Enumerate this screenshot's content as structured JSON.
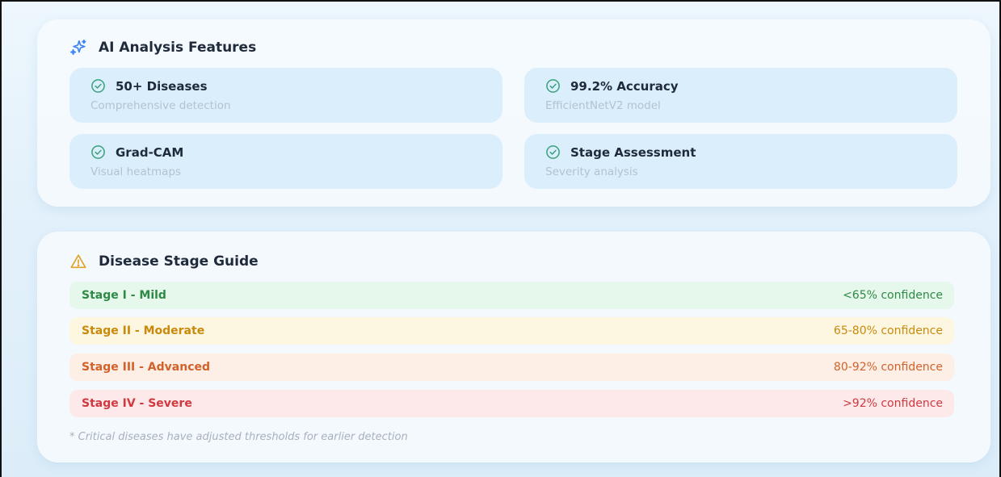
{
  "features": {
    "title": "AI Analysis Features",
    "icon": "sparkles-icon",
    "items": [
      {
        "title": "50+ Diseases",
        "subtitle": "Comprehensive detection",
        "icon": "check-circle-icon"
      },
      {
        "title": "99.2% Accuracy",
        "subtitle": "EfficientNetV2 model",
        "icon": "check-circle-icon"
      },
      {
        "title": "Grad-CAM",
        "subtitle": "Visual heatmaps",
        "icon": "check-circle-icon"
      },
      {
        "title": "Stage Assessment",
        "subtitle": "Severity analysis",
        "icon": "check-circle-icon"
      }
    ]
  },
  "stages": {
    "title": "Disease Stage Guide",
    "icon": "warning-triangle-icon",
    "rows": [
      {
        "name": "Stage I - Mild",
        "confidence": "<65% confidence",
        "color": "#2f8a45",
        "bg": "#e6f7ec"
      },
      {
        "name": "Stage II - Moderate",
        "confidence": "65-80% confidence",
        "color": "#c98a0c",
        "bg": "#fdf7e1"
      },
      {
        "name": "Stage III - Advanced",
        "confidence": "80-92% confidence",
        "color": "#d2622a",
        "bg": "#fdeee6"
      },
      {
        "name": "Stage IV - Severe",
        "confidence": ">92% confidence",
        "color": "#d0393f",
        "bg": "#fde9ea"
      }
    ],
    "footnote": "* Critical diseases have adjusted thresholds for earlier detection"
  },
  "colors": {
    "check_accent": "#3aa17c",
    "warning_accent": "#e0a326",
    "sparkle_accent": "#3b82f6"
  }
}
